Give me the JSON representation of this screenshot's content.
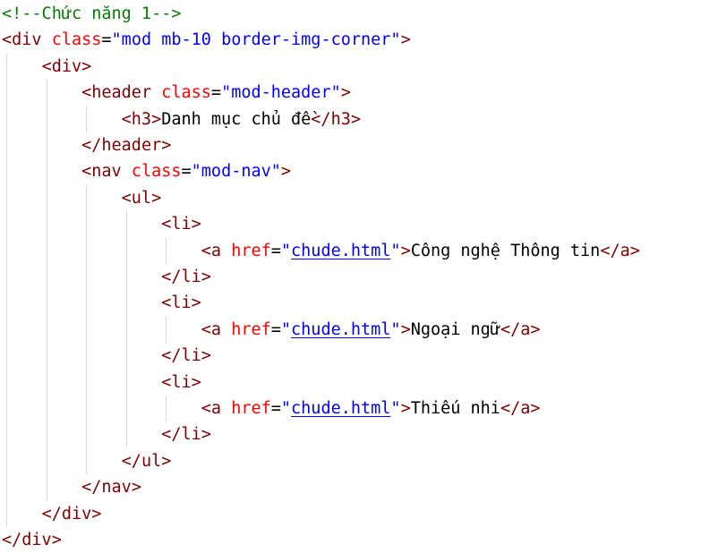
{
  "editor": {
    "language": "html",
    "colors": {
      "comment": "#008000",
      "tag": "#800000",
      "attribute": "#ff0000",
      "string": "#0000ff",
      "text": "#000000",
      "indent_guide": "#d7d7d7"
    },
    "lines": [
      [
        {
          "t": "comment",
          "v": "<!--Chức năng 1-->"
        }
      ],
      [
        {
          "t": "punct",
          "v": "<"
        },
        {
          "t": "tag",
          "v": "div"
        },
        {
          "t": "text",
          "v": " "
        },
        {
          "t": "attr",
          "v": "class"
        },
        {
          "t": "eq",
          "v": "="
        },
        {
          "t": "str",
          "v": "\"mod mb-10 border-img-corner\""
        },
        {
          "t": "punct",
          "v": ">"
        }
      ],
      [
        {
          "t": "text",
          "v": "    "
        },
        {
          "t": "punct",
          "v": "<"
        },
        {
          "t": "tag",
          "v": "div"
        },
        {
          "t": "punct",
          "v": ">"
        }
      ],
      [
        {
          "t": "text",
          "v": "        "
        },
        {
          "t": "punct",
          "v": "<"
        },
        {
          "t": "tag",
          "v": "header"
        },
        {
          "t": "text",
          "v": " "
        },
        {
          "t": "attr",
          "v": "class"
        },
        {
          "t": "eq",
          "v": "="
        },
        {
          "t": "str",
          "v": "\"mod-header\""
        },
        {
          "t": "punct",
          "v": ">"
        }
      ],
      [
        {
          "t": "text",
          "v": "            "
        },
        {
          "t": "punct",
          "v": "<"
        },
        {
          "t": "tag",
          "v": "h3"
        },
        {
          "t": "punct",
          "v": ">"
        },
        {
          "t": "text",
          "v": "Danh mục chủ đề"
        },
        {
          "t": "punct",
          "v": "</"
        },
        {
          "t": "tag",
          "v": "h3"
        },
        {
          "t": "punct",
          "v": ">"
        }
      ],
      [
        {
          "t": "text",
          "v": "        "
        },
        {
          "t": "punct",
          "v": "</"
        },
        {
          "t": "tag",
          "v": "header"
        },
        {
          "t": "punct",
          "v": ">"
        }
      ],
      [
        {
          "t": "text",
          "v": "        "
        },
        {
          "t": "punct",
          "v": "<"
        },
        {
          "t": "tag",
          "v": "nav"
        },
        {
          "t": "text",
          "v": " "
        },
        {
          "t": "attr",
          "v": "class"
        },
        {
          "t": "eq",
          "v": "="
        },
        {
          "t": "str",
          "v": "\"mod-nav\""
        },
        {
          "t": "punct",
          "v": ">"
        }
      ],
      [
        {
          "t": "text",
          "v": "            "
        },
        {
          "t": "punct",
          "v": "<"
        },
        {
          "t": "tag",
          "v": "ul"
        },
        {
          "t": "punct",
          "v": ">"
        }
      ],
      [
        {
          "t": "text",
          "v": "                "
        },
        {
          "t": "punct",
          "v": "<"
        },
        {
          "t": "tag",
          "v": "li"
        },
        {
          "t": "punct",
          "v": ">"
        }
      ],
      [
        {
          "t": "text",
          "v": "                    "
        },
        {
          "t": "punct",
          "v": "<"
        },
        {
          "t": "tag",
          "v": "a"
        },
        {
          "t": "text",
          "v": " "
        },
        {
          "t": "attr",
          "v": "href"
        },
        {
          "t": "eq",
          "v": "="
        },
        {
          "t": "str",
          "v": "\""
        },
        {
          "t": "link",
          "v": "chude.html"
        },
        {
          "t": "str",
          "v": "\""
        },
        {
          "t": "punct",
          "v": ">"
        },
        {
          "t": "text",
          "v": "Công nghệ Thông tin"
        },
        {
          "t": "punct",
          "v": "</"
        },
        {
          "t": "tag",
          "v": "a"
        },
        {
          "t": "punct",
          "v": ">"
        }
      ],
      [
        {
          "t": "text",
          "v": "                "
        },
        {
          "t": "punct",
          "v": "</"
        },
        {
          "t": "tag",
          "v": "li"
        },
        {
          "t": "punct",
          "v": ">"
        }
      ],
      [
        {
          "t": "text",
          "v": "                "
        },
        {
          "t": "punct",
          "v": "<"
        },
        {
          "t": "tag",
          "v": "li"
        },
        {
          "t": "punct",
          "v": ">"
        }
      ],
      [
        {
          "t": "text",
          "v": "                    "
        },
        {
          "t": "punct",
          "v": "<"
        },
        {
          "t": "tag",
          "v": "a"
        },
        {
          "t": "text",
          "v": " "
        },
        {
          "t": "attr",
          "v": "href"
        },
        {
          "t": "eq",
          "v": "="
        },
        {
          "t": "str",
          "v": "\""
        },
        {
          "t": "link",
          "v": "chude.html"
        },
        {
          "t": "str",
          "v": "\""
        },
        {
          "t": "punct",
          "v": ">"
        },
        {
          "t": "text",
          "v": "Ngoại ngữ"
        },
        {
          "t": "punct",
          "v": "</"
        },
        {
          "t": "tag",
          "v": "a"
        },
        {
          "t": "punct",
          "v": ">"
        }
      ],
      [
        {
          "t": "text",
          "v": "                "
        },
        {
          "t": "punct",
          "v": "</"
        },
        {
          "t": "tag",
          "v": "li"
        },
        {
          "t": "punct",
          "v": ">"
        }
      ],
      [
        {
          "t": "text",
          "v": "                "
        },
        {
          "t": "punct",
          "v": "<"
        },
        {
          "t": "tag",
          "v": "li"
        },
        {
          "t": "punct",
          "v": ">"
        }
      ],
      [
        {
          "t": "text",
          "v": "                    "
        },
        {
          "t": "punct",
          "v": "<"
        },
        {
          "t": "tag",
          "v": "a"
        },
        {
          "t": "text",
          "v": " "
        },
        {
          "t": "attr",
          "v": "href"
        },
        {
          "t": "eq",
          "v": "="
        },
        {
          "t": "str",
          "v": "\""
        },
        {
          "t": "link",
          "v": "chude.html"
        },
        {
          "t": "str",
          "v": "\""
        },
        {
          "t": "punct",
          "v": ">"
        },
        {
          "t": "text",
          "v": "Thiếu nhi"
        },
        {
          "t": "punct",
          "v": "</"
        },
        {
          "t": "tag",
          "v": "a"
        },
        {
          "t": "punct",
          "v": ">"
        }
      ],
      [
        {
          "t": "text",
          "v": "                "
        },
        {
          "t": "punct",
          "v": "</"
        },
        {
          "t": "tag",
          "v": "li"
        },
        {
          "t": "punct",
          "v": ">"
        }
      ],
      [
        {
          "t": "text",
          "v": "            "
        },
        {
          "t": "punct",
          "v": "</"
        },
        {
          "t": "tag",
          "v": "ul"
        },
        {
          "t": "punct",
          "v": ">"
        }
      ],
      [
        {
          "t": "text",
          "v": "        "
        },
        {
          "t": "punct",
          "v": "</"
        },
        {
          "t": "tag",
          "v": "nav"
        },
        {
          "t": "punct",
          "v": ">"
        }
      ],
      [
        {
          "t": "text",
          "v": "    "
        },
        {
          "t": "punct",
          "v": "</"
        },
        {
          "t": "tag",
          "v": "div"
        },
        {
          "t": "punct",
          "v": ">"
        }
      ],
      [
        {
          "t": "punct",
          "v": "</"
        },
        {
          "t": "tag",
          "v": "div"
        },
        {
          "t": "punct",
          "v": ">"
        }
      ]
    ]
  }
}
